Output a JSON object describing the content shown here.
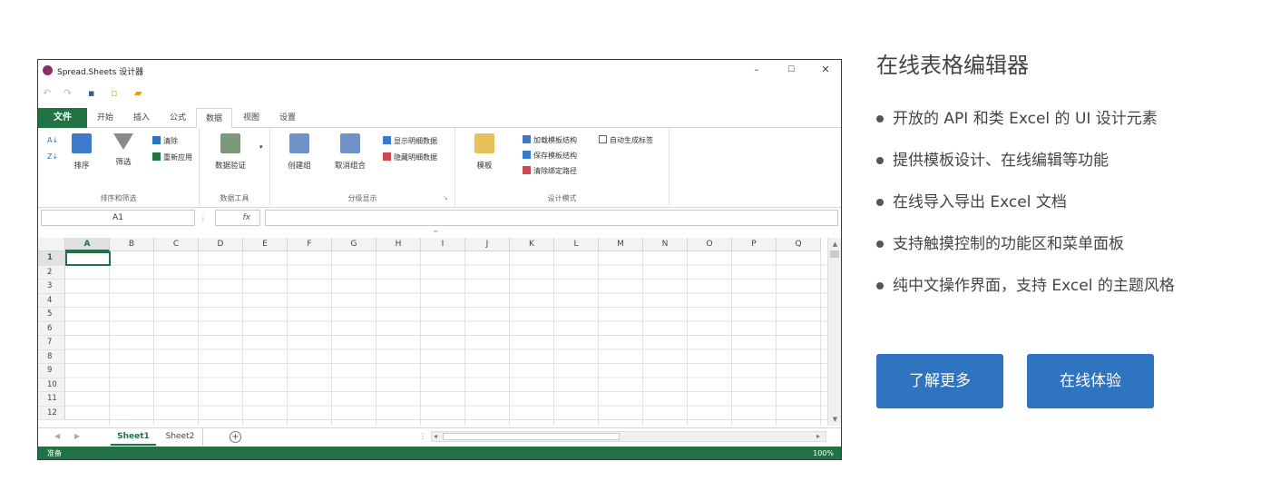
{
  "window": {
    "title": "Spread.Sheets 设计器",
    "controls": {
      "minimize": "–",
      "maximize": "☐",
      "close": "✕"
    }
  },
  "quick_access": [
    "undo-icon",
    "redo-icon",
    "save-icon",
    "new-icon",
    "open-icon"
  ],
  "tabs": [
    {
      "label": "文件",
      "kind": "file"
    },
    {
      "label": "开始"
    },
    {
      "label": "插入"
    },
    {
      "label": "公式"
    },
    {
      "label": "数据",
      "active": true
    },
    {
      "label": "视图"
    },
    {
      "label": "设置"
    }
  ],
  "ribbon": {
    "sort_filter": {
      "label": "排序和筛选",
      "sort": "排序",
      "filter": "筛选",
      "clear": "清除",
      "reapply": "重新应用"
    },
    "data_tools": {
      "label": "数据工具",
      "validation": "数据验证"
    },
    "outline": {
      "label": "分级显示",
      "group": "创建组",
      "ungroup": "取消组合",
      "show_detail": "显示明细数据",
      "hide_detail": "隐藏明细数据"
    },
    "template": {
      "label": "设计模式",
      "template": "模板",
      "load_schema": "加载模板结构",
      "save_schema": "保存模板结构",
      "clear_binding": "清除绑定路径",
      "auto_label": "自动生成标签"
    }
  },
  "formula_bar": {
    "name_box": "A1",
    "fx": "fx",
    "formula": ""
  },
  "grid": {
    "columns": [
      "A",
      "B",
      "C",
      "D",
      "E",
      "F",
      "G",
      "H",
      "I",
      "J",
      "K",
      "L",
      "M",
      "N",
      "O",
      "P",
      "Q"
    ],
    "rows": [
      "1",
      "2",
      "3",
      "4",
      "5",
      "6",
      "7",
      "8",
      "9",
      "10",
      "11",
      "12"
    ],
    "selected": "A1"
  },
  "sheets": [
    {
      "label": "Sheet1",
      "active": true
    },
    {
      "label": "Sheet2"
    }
  ],
  "add_sheet": "+",
  "status": {
    "left": "准备",
    "zoom": "100%"
  },
  "panel": {
    "title": "在线表格编辑器",
    "features": [
      "开放的 API 和类 Excel 的 UI 设计元素",
      "提供模板设计、在线编辑等功能",
      "在线导入导出 Excel 文档",
      "支持触摸控制的功能区和菜单面板",
      "纯中文操作界面，支持 Excel 的主题风格"
    ],
    "learn_more": "了解更多",
    "try_online": "在线体验"
  },
  "colors": {
    "excel_green": "#217346",
    "button_blue": "#2f74c0",
    "app_icon": "#8f2f6a"
  }
}
